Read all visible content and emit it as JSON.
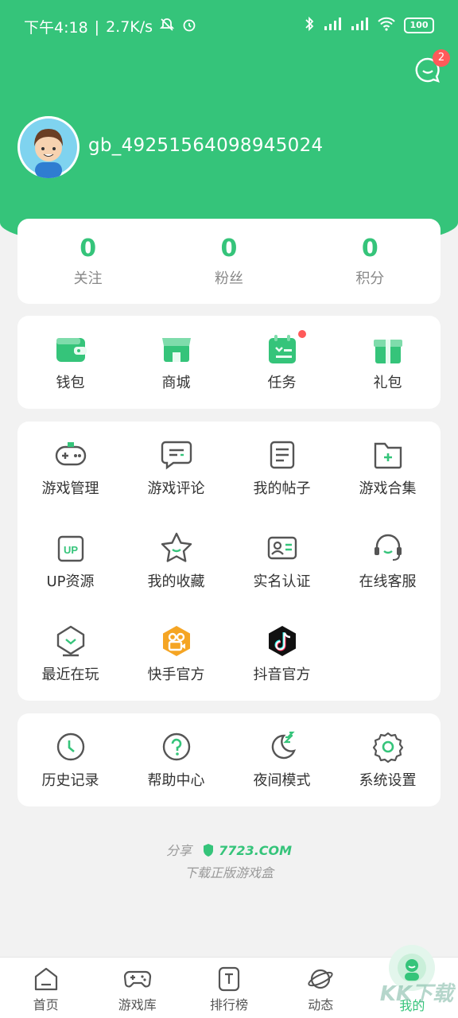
{
  "status_bar": {
    "time": "下午4:18",
    "speed": "2.7K/s",
    "battery": "100"
  },
  "header": {
    "message_badge": "2",
    "username": "gb_49251564098945024"
  },
  "stats": [
    {
      "value": "0",
      "label": "关注"
    },
    {
      "value": "0",
      "label": "粉丝"
    },
    {
      "value": "0",
      "label": "积分"
    }
  ],
  "quick": [
    {
      "label": "钱包",
      "icon": "wallet-icon"
    },
    {
      "label": "商城",
      "icon": "shop-icon"
    },
    {
      "label": "任务",
      "icon": "task-icon"
    },
    {
      "label": "礼包",
      "icon": "gift-icon"
    }
  ],
  "features": [
    {
      "label": "游戏管理",
      "icon": "gamepad-icon"
    },
    {
      "label": "游戏评论",
      "icon": "comment-icon"
    },
    {
      "label": "我的帖子",
      "icon": "post-icon"
    },
    {
      "label": "游戏合集",
      "icon": "folder-add-icon"
    },
    {
      "label": "UP资源",
      "icon": "up-icon"
    },
    {
      "label": "我的收藏",
      "icon": "star-icon"
    },
    {
      "label": "实名认证",
      "icon": "id-card-icon"
    },
    {
      "label": "在线客服",
      "icon": "headset-icon"
    },
    {
      "label": "最近在玩",
      "icon": "recent-icon"
    },
    {
      "label": "快手官方",
      "icon": "kuaishou-icon"
    },
    {
      "label": "抖音官方",
      "icon": "douyin-icon"
    }
  ],
  "settings": [
    {
      "label": "历史记录",
      "icon": "clock-icon"
    },
    {
      "label": "帮助中心",
      "icon": "help-icon"
    },
    {
      "label": "夜间模式",
      "icon": "moon-icon"
    },
    {
      "label": "系统设置",
      "icon": "gear-icon"
    }
  ],
  "footer": {
    "share": "分享",
    "brand": "7723.COM",
    "slogan": "下载正版游戏盒"
  },
  "tabs": [
    {
      "label": "首页",
      "icon": "home-icon"
    },
    {
      "label": "游戏库",
      "icon": "gamepad-icon"
    },
    {
      "label": "排行榜",
      "icon": "rank-icon"
    },
    {
      "label": "动态",
      "icon": "planet-icon"
    },
    {
      "label": "我的",
      "icon": "profile-icon"
    }
  ],
  "watermark": "KK下载",
  "colors": {
    "accent": "#35c47a",
    "badge": "#ff5a5a"
  }
}
